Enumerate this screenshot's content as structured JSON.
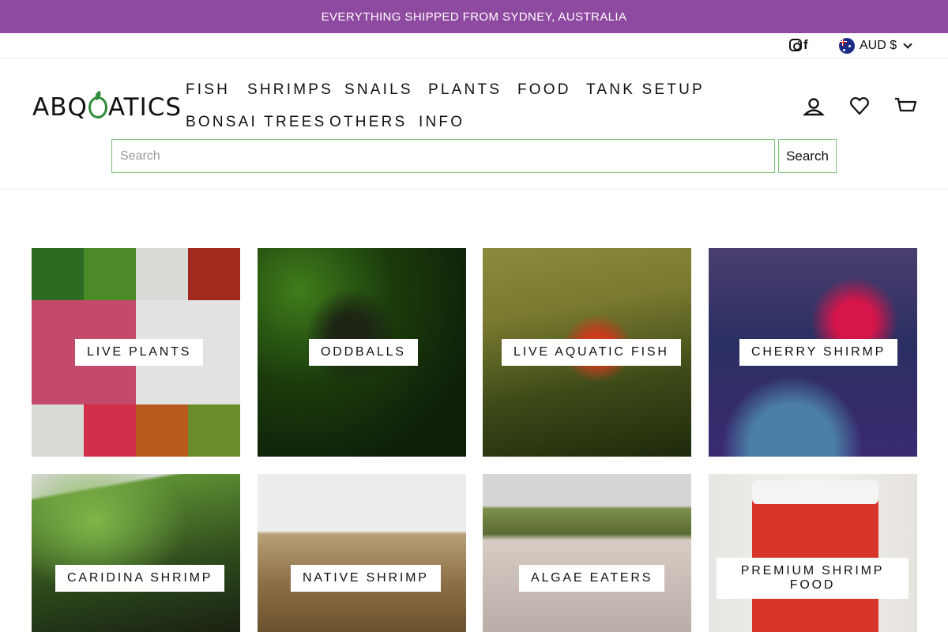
{
  "announcement": "EVERYTHING SHIPPED FROM SYDNEY, AUSTRALIA",
  "utility": {
    "social": [
      "instagram-icon",
      "facebook-icon"
    ],
    "facebook_glyph": "f",
    "currency": "AUD $"
  },
  "brand": {
    "logo_left": "ABQ",
    "logo_right": "ATICS"
  },
  "nav": {
    "items": [
      "FISH",
      "SHRIMPS",
      "SNAILS",
      "PLANTS",
      "FOOD",
      "TANK SETUP",
      "BONSAI TREES",
      "OTHERS",
      "INFO"
    ]
  },
  "header_icons": [
    "account-icon",
    "wishlist-icon",
    "cart-icon"
  ],
  "search": {
    "placeholder": "Search",
    "button": "Search"
  },
  "collections": [
    {
      "label": "LIVE PLANTS"
    },
    {
      "label": "ODDBALLS"
    },
    {
      "label": "LIVE AQUATIC FISH"
    },
    {
      "label": "CHERRY SHIRMP"
    },
    {
      "label": "CARIDINA SHRIMP"
    },
    {
      "label": "NATIVE SHRIMP"
    },
    {
      "label": "ALGAE EATERS"
    },
    {
      "label": "PREMIUM SHRIMP FOOD"
    }
  ],
  "colors": {
    "announcement_bg": "#8e4aa0",
    "search_border": "#7cbf7a",
    "logo_accent": "#2f8c3a"
  }
}
